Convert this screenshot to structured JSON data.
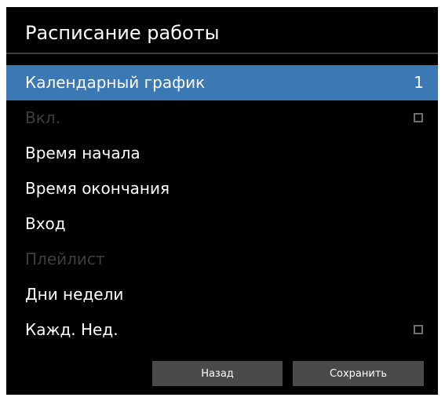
{
  "window": {
    "title": "Расписание работы"
  },
  "menu": {
    "items": [
      {
        "label": "Календарный график",
        "value": "1",
        "state": "selected"
      },
      {
        "label": "Вкл.",
        "state": "disabled",
        "checked": false
      },
      {
        "label": "Время начала",
        "state": "normal"
      },
      {
        "label": "Время окончания",
        "state": "normal"
      },
      {
        "label": "Вход",
        "state": "normal"
      },
      {
        "label": "Плейлист",
        "state": "disabled"
      },
      {
        "label": "Дни недели",
        "state": "normal"
      },
      {
        "label": "Кажд. Нед.",
        "state": "normal",
        "checked": false
      }
    ]
  },
  "buttons": {
    "back_label": "Назад",
    "save_label": "Сохранить"
  },
  "colors": {
    "background": "#000000",
    "selected_row": "#3b78b4",
    "disabled_text": "#3e3e3e",
    "button_bg": "#4a4a4a",
    "text": "#ffffff"
  }
}
